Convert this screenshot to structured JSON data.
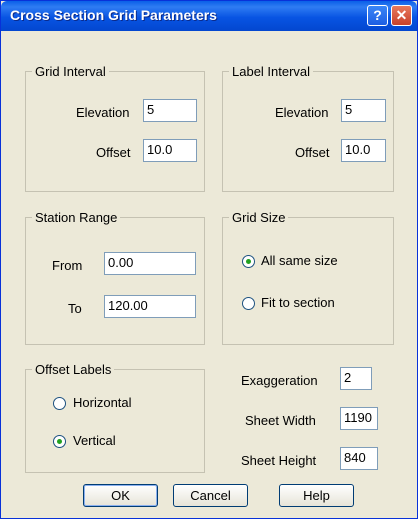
{
  "window": {
    "title": "Cross Section Grid Parameters",
    "help_icon": "?",
    "close_icon": "✕"
  },
  "grid_interval": {
    "title": "Grid Interval",
    "elevation_label": "Elevation",
    "elevation_value": "5",
    "offset_label": "Offset",
    "offset_value": "10.0"
  },
  "label_interval": {
    "title": "Label Interval",
    "elevation_label": "Elevation",
    "elevation_value": "5",
    "offset_label": "Offset",
    "offset_value": "10.0"
  },
  "station_range": {
    "title": "Station Range",
    "from_label": "From",
    "from_value": "0.00",
    "to_label": "To",
    "to_value": "120.00"
  },
  "grid_size": {
    "title": "Grid Size",
    "options": [
      {
        "label": "All same size",
        "checked": true
      },
      {
        "label": "Fit to section",
        "checked": false
      }
    ]
  },
  "offset_labels": {
    "title": "Offset Labels",
    "options": [
      {
        "label": "Horizontal",
        "checked": false
      },
      {
        "label": "Vertical",
        "checked": true
      }
    ]
  },
  "sheet": {
    "exaggeration_label": "Exaggeration",
    "exaggeration_value": "2",
    "width_label": "Sheet Width",
    "width_value": "1190",
    "height_label": "Sheet Height",
    "height_value": "840"
  },
  "buttons": {
    "ok": "OK",
    "cancel": "Cancel",
    "help": "Help"
  }
}
